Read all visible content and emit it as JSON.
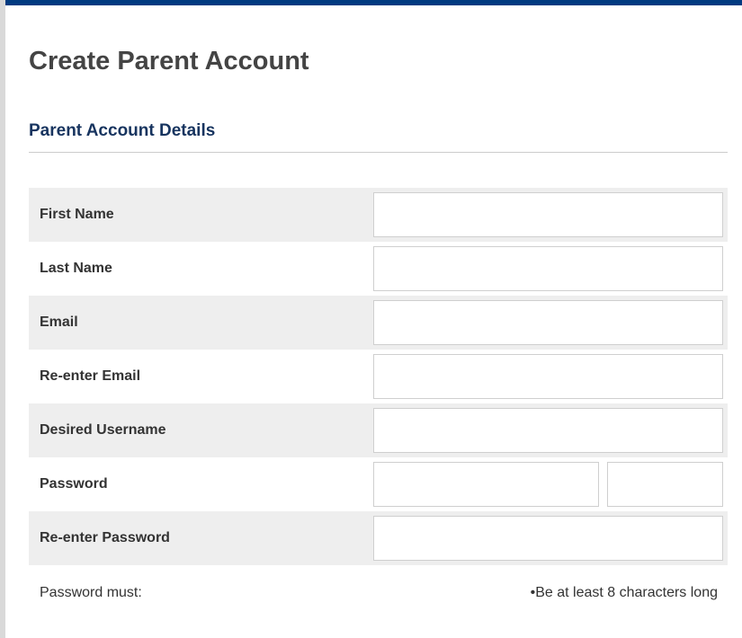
{
  "page": {
    "title": "Create Parent Account"
  },
  "section": {
    "heading": "Parent Account Details"
  },
  "form": {
    "fields": [
      {
        "label": "First Name",
        "value": ""
      },
      {
        "label": "Last Name",
        "value": ""
      },
      {
        "label": "Email",
        "value": ""
      },
      {
        "label": "Re-enter Email",
        "value": ""
      },
      {
        "label": "Desired Username",
        "value": ""
      },
      {
        "label": "Password",
        "value": "",
        "secondary_value": ""
      },
      {
        "label": "Re-enter Password",
        "value": ""
      }
    ]
  },
  "password_rules": {
    "label": "Password must:",
    "items": [
      "•Be at least 8 characters long"
    ]
  },
  "colors": {
    "top_bar": "#003a80",
    "section_heading": "#17345f",
    "row_shade": "#eeeeee"
  }
}
